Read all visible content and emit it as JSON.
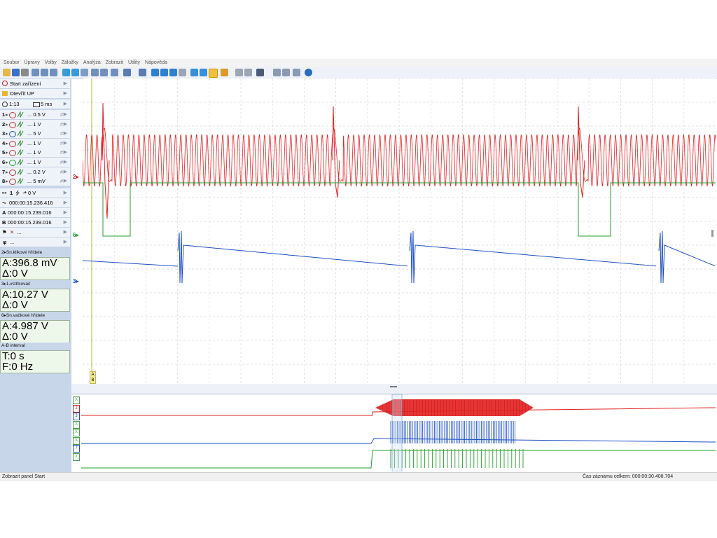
{
  "menu": [
    "Soubor",
    "Úpravy",
    "Volby",
    "Záložky",
    "Analýza",
    "Zobrazit",
    "Utility",
    "Nápověda"
  ],
  "left_panel": {
    "start_device": "Start zařízení",
    "open_up": "Otevřít UP",
    "zoom_label": "1:13",
    "timebase_label": "5 ms",
    "channels": [
      {
        "num": "1",
        "scale": "0.5 V",
        "color": "#c03030"
      },
      {
        "num": "2",
        "scale": "1 V",
        "color": "#c03030"
      },
      {
        "num": "3",
        "scale": "5 V",
        "color": "#1d4fc2"
      },
      {
        "num": "4",
        "scale": "1 V",
        "color": "#c03030"
      },
      {
        "num": "5",
        "scale": "1 V",
        "color": "#c03030"
      },
      {
        "num": "6",
        "scale": "1 V",
        "color": "#22a02a"
      },
      {
        "num": "7",
        "scale": "0.2 V",
        "color": "#c03030"
      },
      {
        "num": "8",
        "scale": "5 mV",
        "color": "#c03030"
      }
    ],
    "trigger_label": "1",
    "trigger_value": "0 V",
    "cursor_time": "000:00:15.236.416",
    "cursor_a_time": "000:00:15.239.016",
    "cursor_b_time": "000:00:15.239.016",
    "marker_label": "...",
    "phi_label": "...",
    "readouts": [
      {
        "header": "2▸Sn.klikové hřídele",
        "line1": "A:396.8 mV",
        "line2": "Δ:0 V"
      },
      {
        "header": "3▸1.vstřikovač",
        "line1": "A:10.27 V",
        "line2": "Δ:0 V"
      },
      {
        "header": "6▸Sn.vačkové hřídele",
        "line1": "A:4.987 V",
        "line2": "Δ:0 V"
      },
      {
        "header": "A-B interval",
        "line1": "T:0 s",
        "line2": "F:0 Hz"
      }
    ]
  },
  "plot": {
    "channel_markers": [
      {
        "label": "2▸",
        "color": "#d42020"
      },
      {
        "label": "6▸",
        "color": "#22a02a"
      },
      {
        "label": "3▸",
        "color": "#1d4fc2"
      }
    ],
    "cursor_labels": [
      "A",
      "B"
    ],
    "colors": {
      "crank": "#e02020",
      "cam": "#22a02a",
      "injector": "#1d4fc2",
      "cursor": "#b9b83a",
      "grid": "#d8d8d8"
    }
  },
  "overview": {
    "channel_tags": [
      "X",
      "2",
      "3",
      "X",
      "X",
      "X",
      "7",
      "X"
    ]
  },
  "status": {
    "left": "Zobrazit panel Start",
    "right": "Čas záznamu celkem: 000:00:30.408.704"
  }
}
